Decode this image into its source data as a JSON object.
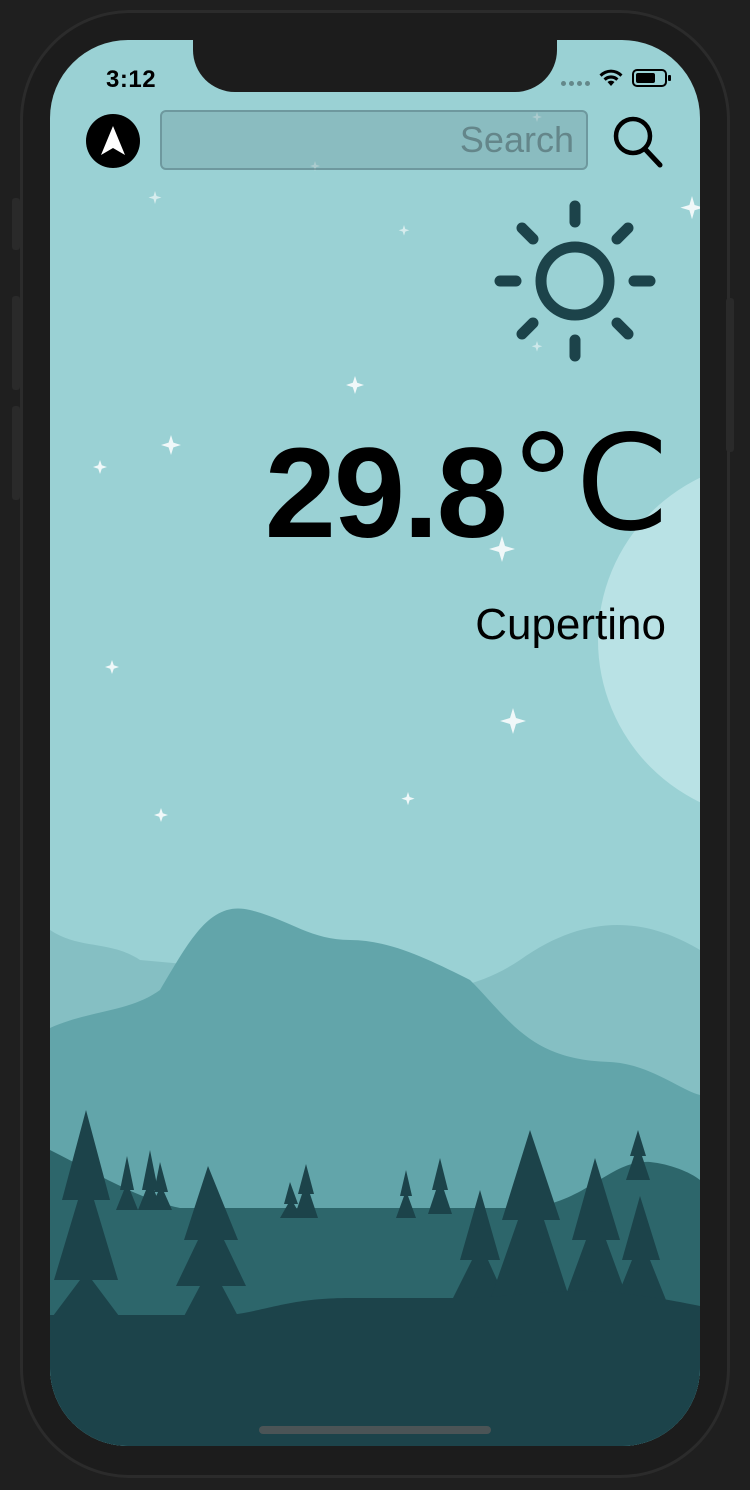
{
  "status_bar": {
    "time": "3:12"
  },
  "search": {
    "placeholder": "Search"
  },
  "weather": {
    "condition_icon": "sun-icon",
    "temperature": "29.8",
    "unit": "°C",
    "city": "Cupertino"
  },
  "icons": {
    "location": "location-arrow-icon",
    "search": "magnifying-glass-icon",
    "wifi": "wifi-icon",
    "battery": "battery-icon"
  },
  "colors": {
    "sky": "#9ad1d4",
    "moon": "#b9e2e5",
    "far_hills": "#85bfc3",
    "mid_hills": "#62a5aa",
    "near_hills": "#2d666b",
    "foreground": "#1c434a",
    "sun_stroke": "#1c434a"
  }
}
